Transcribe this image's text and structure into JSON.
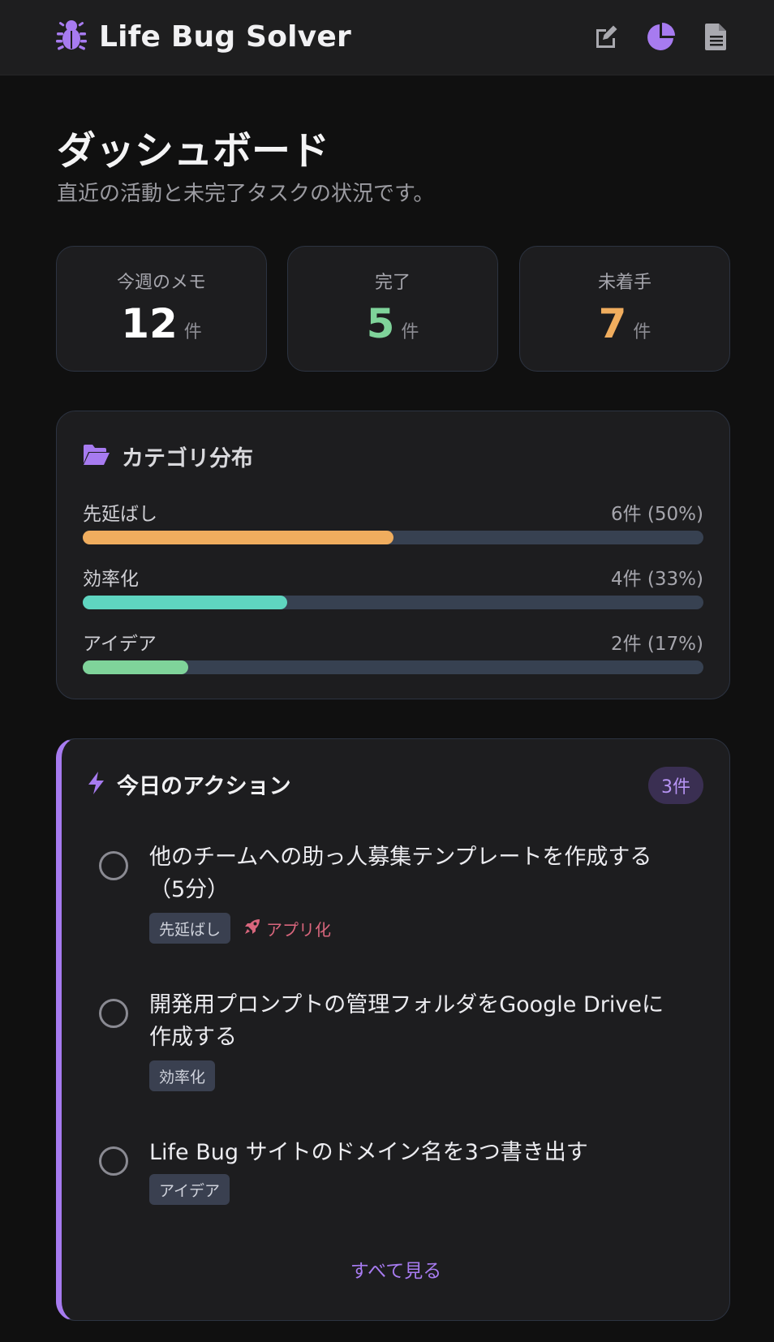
{
  "app": {
    "title": "Life Bug Solver",
    "accent": "#a77bf0"
  },
  "nav": {
    "icons": [
      "edit-icon",
      "pie-chart-icon",
      "document-icon"
    ]
  },
  "page": {
    "title": "ダッシュボード",
    "subtitle": "直近の活動と未完了タスクの状況です。"
  },
  "stats": [
    {
      "label": "今週のメモ",
      "value": "12",
      "unit": "件",
      "color": "#ffffff"
    },
    {
      "label": "完了",
      "value": "5",
      "unit": "件",
      "color": "#7fd39a"
    },
    {
      "label": "未着手",
      "value": "7",
      "unit": "件",
      "color": "#f0ad5e"
    }
  ],
  "categories": {
    "title": "カテゴリ分布",
    "items": [
      {
        "name": "先延ばし",
        "count": "6件 (50%)",
        "fraction": 0.5,
        "color": "#f0ad5e"
      },
      {
        "name": "効率化",
        "count": "4件 (33%)",
        "fraction": 0.33,
        "color": "#5fd5c0"
      },
      {
        "name": "アイデア",
        "count": "2件 (17%)",
        "fraction": 0.17,
        "color": "#7fd39a"
      }
    ]
  },
  "actions": {
    "title": "今日のアクション",
    "badge": "3件",
    "tasks": [
      {
        "text": "他のチームへの助っ人募集テンプレートを作成する（5分）",
        "tag": "先延ばし",
        "extra_tag": "アプリ化"
      },
      {
        "text": "開発用プロンプトの管理フォルダをGoogle Driveに作成する",
        "tag": "効率化"
      },
      {
        "text": "Life Bug サイトのドメイン名を3つ書き出す",
        "tag": "アイデア"
      }
    ],
    "see_all": "すべて見る"
  }
}
